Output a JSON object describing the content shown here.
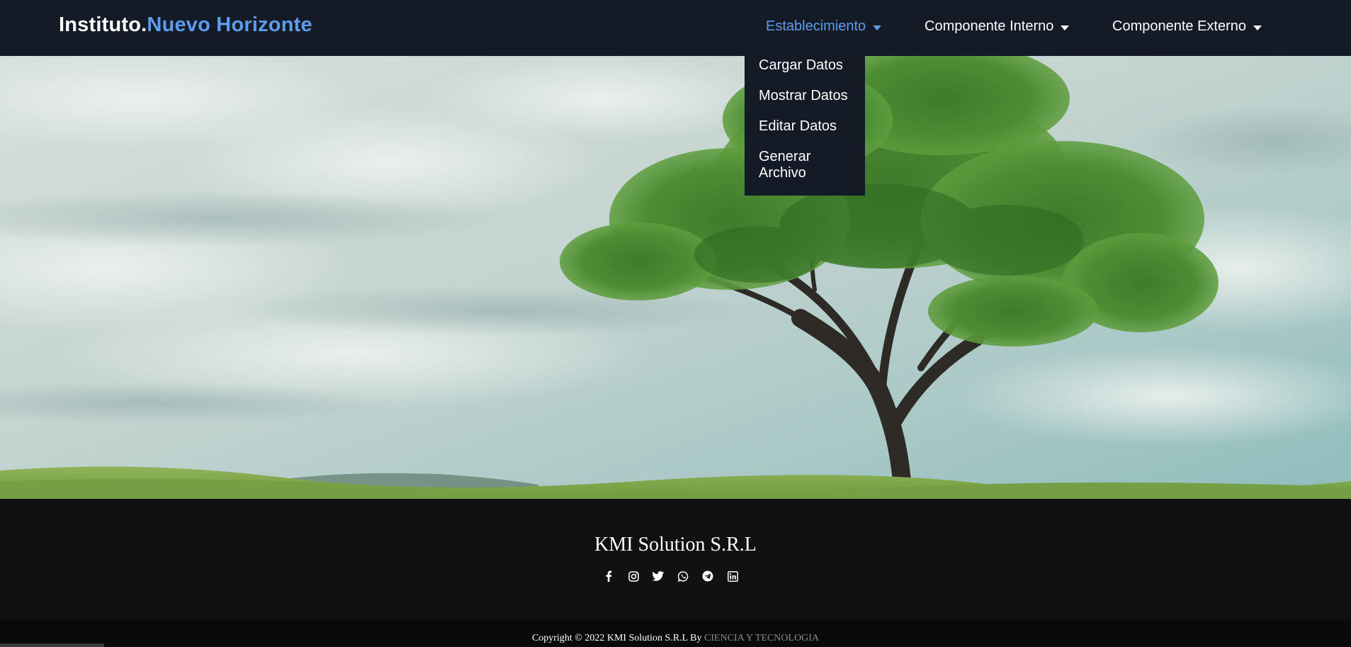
{
  "brand": {
    "part1": "Instituto.",
    "part2": "Nuevo Horizonte"
  },
  "nav": {
    "items": [
      {
        "label": "Establecimiento",
        "active": true
      },
      {
        "label": "Componente Interno",
        "active": false
      },
      {
        "label": "Componente Externo",
        "active": false
      }
    ]
  },
  "dropdown": {
    "items": [
      "Cargar Datos",
      "Mostrar Datos",
      "Editar Datos",
      "Generar Archivo"
    ]
  },
  "footer": {
    "title": "KMI Solution S.R.L",
    "socials": [
      "facebook-icon",
      "instagram-icon",
      "twitter-icon",
      "whatsapp-icon",
      "telegram-icon",
      "linkedin-icon"
    ],
    "copyright_prefix": "Copyright © 2022 KMI Solution S.R.L By",
    "copyright_link": "CIENCIA Y TECNOLOGIA"
  },
  "colors": {
    "navbar_bg": "#141b27",
    "accent": "#5d9cec",
    "footer_bg": "#111111"
  }
}
